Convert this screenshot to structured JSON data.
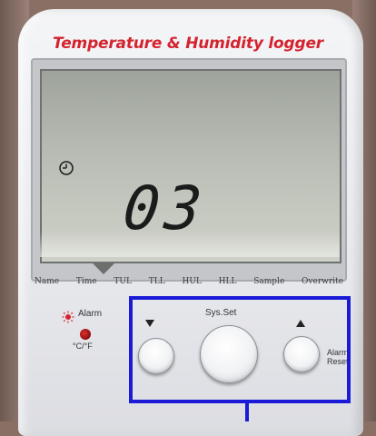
{
  "device": {
    "title": "Temperature & Humidity logger",
    "display_value": "03",
    "labels": [
      "Name",
      "Time",
      "TUL",
      "TLL",
      "HUL",
      "HLL",
      "Sample",
      "Overwrite"
    ],
    "alarm_label": "Alarm",
    "unit_label": "°C/°F",
    "sysset_label": "Sys.Set",
    "alarm_reset_label": "Alarm Reset"
  },
  "colors": {
    "title": "#d4232f",
    "highlight": "#1b1ad6",
    "led": "#c81c1c"
  },
  "icons": [
    "clock-icon",
    "sun-icon",
    "arrow-down-icon",
    "arrow-up-icon"
  ]
}
